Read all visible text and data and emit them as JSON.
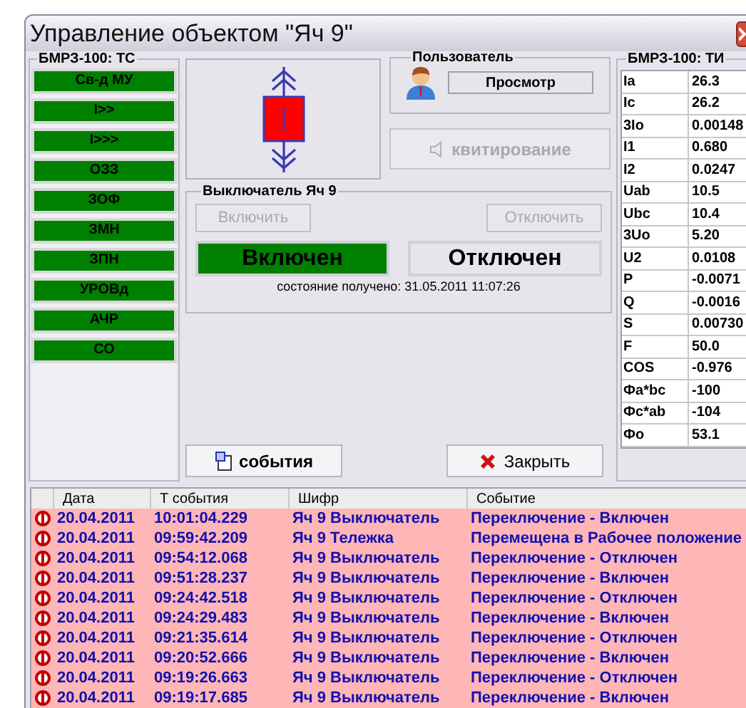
{
  "window": {
    "title": "Управление объектом \"Яч 9\""
  },
  "ts_panel": {
    "title": "БМРЗ-100: ТС",
    "items": [
      {
        "label": "Св-д МУ",
        "on": true
      },
      {
        "label": "I>>",
        "on": true
      },
      {
        "label": "I>>>",
        "on": true
      },
      {
        "label": "ОЗЗ",
        "on": true
      },
      {
        "label": "ЗОФ",
        "on": true
      },
      {
        "label": "ЗМН",
        "on": true
      },
      {
        "label": "ЗПН",
        "on": true
      },
      {
        "label": "УРОВд",
        "on": true
      },
      {
        "label": "АЧР",
        "on": true
      },
      {
        "label": "СО",
        "on": true
      }
    ]
  },
  "user": {
    "title": "Пользователь",
    "role": "Просмотр"
  },
  "ack_button": {
    "label": "квитирование",
    "disabled": true
  },
  "breaker": {
    "title": "Выключатель Яч 9",
    "buttons": [
      {
        "label": "Включить",
        "disabled": true
      },
      {
        "label": "Отключить",
        "disabled": true
      }
    ],
    "states": [
      {
        "label": "Включен",
        "selected": true
      },
      {
        "label": "Отключен",
        "selected": false
      }
    ],
    "status": "состояние получено: 31.05.2011 11:07:26"
  },
  "footer_buttons": [
    {
      "label": "события",
      "kind": "events"
    },
    {
      "label": "Закрыть",
      "kind": "close"
    }
  ],
  "ti_panel": {
    "title": "БМРЗ-100: ТИ",
    "rows": [
      {
        "name": "Ia",
        "value": "26.3"
      },
      {
        "name": "Ic",
        "value": "26.2"
      },
      {
        "name": "3Io",
        "value": "0.00148"
      },
      {
        "name": "I1",
        "value": "0.680"
      },
      {
        "name": "I2",
        "value": "0.0247"
      },
      {
        "name": "Uab",
        "value": "10.5"
      },
      {
        "name": "Ubc",
        "value": "10.4"
      },
      {
        "name": "3Uo",
        "value": "5.20"
      },
      {
        "name": "U2",
        "value": "0.0108"
      },
      {
        "name": "P",
        "value": "-0.0071"
      },
      {
        "name": "Q",
        "value": "-0.0016"
      },
      {
        "name": "S",
        "value": "0.00730"
      },
      {
        "name": "F",
        "value": "50.0"
      },
      {
        "name": "COS",
        "value": "-0.976"
      },
      {
        "name": "Фa*bc",
        "value": "-100"
      },
      {
        "name": "Фc*ab",
        "value": "-104"
      },
      {
        "name": "Фo",
        "value": "53.1"
      }
    ]
  },
  "events": {
    "columns": [
      "Дата",
      "Т события",
      "Шифр",
      "Событие"
    ],
    "rows": [
      {
        "date": "20.04.2011",
        "time": "10:01:04.229",
        "code": "Яч 9 Выключатель",
        "event": "Переключение - Включен"
      },
      {
        "date": "20.04.2011",
        "time": "09:59:42.209",
        "code": "Яч 9 Тележка",
        "event": "Перемещена в Рабочее положение"
      },
      {
        "date": "20.04.2011",
        "time": "09:54:12.068",
        "code": "Яч 9 Выключатель",
        "event": "Переключение - Отключен"
      },
      {
        "date": "20.04.2011",
        "time": "09:51:28.237",
        "code": "Яч 9 Выключатель",
        "event": "Переключение - Включен"
      },
      {
        "date": "20.04.2011",
        "time": "09:24:42.518",
        "code": "Яч 9 Выключатель",
        "event": "Переключение - Отключен"
      },
      {
        "date": "20.04.2011",
        "time": "09:24:29.483",
        "code": "Яч 9 Выключатель",
        "event": "Переключение - Включен"
      },
      {
        "date": "20.04.2011",
        "time": "09:21:35.614",
        "code": "Яч 9 Выключатель",
        "event": "Переключение - Отключен"
      },
      {
        "date": "20.04.2011",
        "time": "09:20:52.666",
        "code": "Яч 9 Выключатель",
        "event": "Переключение - Включен"
      },
      {
        "date": "20.04.2011",
        "time": "09:19:26.663",
        "code": "Яч 9 Выключатель",
        "event": "Переключение - Отключен"
      },
      {
        "date": "20.04.2011",
        "time": "09:19:17.685",
        "code": "Яч 9 Выключатель",
        "event": "Переключение - Включен"
      }
    ]
  }
}
